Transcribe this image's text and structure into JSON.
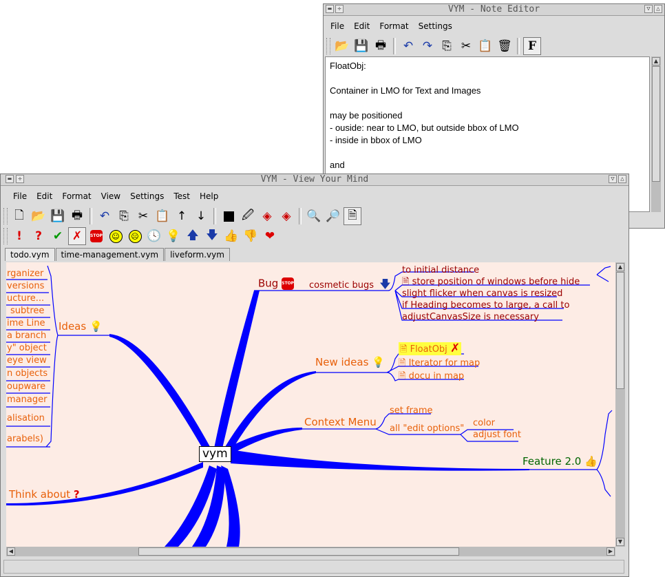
{
  "note_editor": {
    "title": "VYM - Note Editor",
    "menu": [
      "File",
      "Edit",
      "Format",
      "Settings"
    ],
    "toolbar_icons": [
      "open-icon",
      "save-icon",
      "print-icon",
      "undo-icon",
      "redo-icon",
      "copy-icon",
      "cut-icon",
      "paste-icon",
      "delete-icon",
      "font-icon"
    ],
    "lines": [
      "FloatObj:",
      "",
      "Container in LMO for Text and Images",
      "",
      "may be positioned",
      "- ouside: near to LMO, but outside bbox of LMO",
      "- inside in bbox of LMO",
      "",
      "and"
    ]
  },
  "main": {
    "title": "VYM - View Your Mind",
    "menu": [
      "File",
      "Edit",
      "Format",
      "View",
      "Settings",
      "Test",
      "Help"
    ],
    "tabs": [
      "todo.vym",
      "time-management.vym",
      "liveform.vym"
    ],
    "center": "vym",
    "left_branches": [
      "Ideas",
      "Think about"
    ],
    "left_children": [
      "rganizer",
      "versions",
      "ucture...",
      "subtree",
      "ime Line",
      "a branch",
      "y\" object",
      "eye view",
      "n objects",
      "oupware",
      "manager",
      "alisation",
      "arabels)"
    ],
    "bug": {
      "label": "Bug",
      "child": "cosmetic bugs",
      "items": [
        "to initial distance",
        "store position of windows before hide",
        "slight flicker when canvas is resized",
        "if Heading becomes to large, a call to",
        "adjustCanvasSize is necessary"
      ]
    },
    "new_ideas": {
      "label": "New ideas",
      "items": [
        "FloatObj",
        "Iterator for map",
        "docu in map"
      ]
    },
    "context_menu": {
      "label": "Context Menu",
      "items": [
        "set frame",
        "all \"edit options\""
      ],
      "sub": [
        "color",
        "adjust font"
      ]
    },
    "feature": {
      "label": "Feature 2.0"
    }
  },
  "colors": {
    "canvas": "#fdece5",
    "branch": "#0000ff",
    "orange": "#e8600a",
    "darkred": "#9b0000",
    "green": "#006400"
  }
}
